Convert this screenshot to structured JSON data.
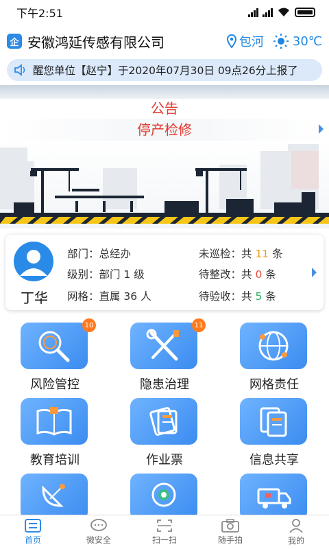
{
  "status": {
    "time": "下午2:51"
  },
  "header": {
    "logo": "企",
    "company": "安徽鸿延传感有限公司",
    "location": "包河",
    "temperature": "30℃"
  },
  "notice": {
    "text": "醒您单位【赵宁】于2020年07月30日 09点26分上报了"
  },
  "announcement": {
    "title": "公告",
    "headline": "停产检修"
  },
  "profile": {
    "name": "丁华",
    "department": "部门：总经办",
    "level": "级别：部门 1 级",
    "grid": "网格：直属 36 人",
    "pending_patrol_prefix": "未巡检：共 ",
    "pending_patrol_count": "11",
    "pending_patrol_suffix": " 条",
    "pending_fix_prefix": "待整改：共 ",
    "pending_fix_count": "0",
    "pending_fix_suffix": " 条",
    "pending_accept_prefix": "待验收：共 ",
    "pending_accept_count": "5",
    "pending_accept_suffix": " 条"
  },
  "tiles": [
    {
      "label": "风险管控",
      "badge": "10",
      "icon": "magnifier-icon"
    },
    {
      "label": "隐患治理",
      "badge": "11",
      "icon": "tools-icon"
    },
    {
      "label": "网格责任",
      "badge": "",
      "icon": "network-globe-icon"
    },
    {
      "label": "教育培训",
      "badge": "",
      "icon": "book-icon"
    },
    {
      "label": "作业票",
      "badge": "",
      "icon": "tickets-icon"
    },
    {
      "label": "信息共享",
      "badge": "",
      "icon": "documents-icon"
    },
    {
      "label": "",
      "badge": "",
      "icon": "satellite-dish-icon"
    },
    {
      "label": "",
      "badge": "",
      "icon": "camera-icon"
    },
    {
      "label": "",
      "badge": "",
      "icon": "truck-icon"
    }
  ],
  "tabbar": [
    {
      "label": "首页",
      "icon": "home-list-icon",
      "active": true
    },
    {
      "label": "微安全",
      "icon": "chat-bubble-icon",
      "active": false
    },
    {
      "label": "扫一扫",
      "icon": "scan-icon",
      "active": false
    },
    {
      "label": "随手拍",
      "icon": "camera-icon",
      "active": false
    },
    {
      "label": "我的",
      "icon": "user-icon",
      "active": false
    }
  ],
  "colors": {
    "accent": "#2e8ae6",
    "red_text": "#e03a2f",
    "badge": "#ff7a1f"
  }
}
